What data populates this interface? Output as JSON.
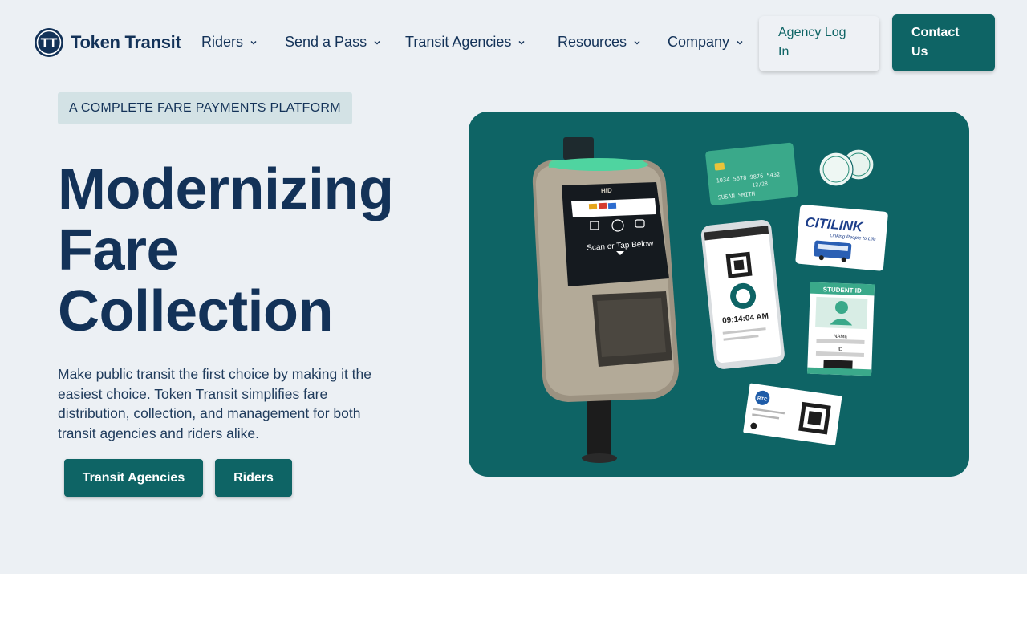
{
  "brand": {
    "name": "Token Transit",
    "logo_glyph": "TT",
    "accent": "#0e6465",
    "text_color": "#133258"
  },
  "nav": {
    "items": [
      {
        "label": "Riders",
        "icon": "chevron-down-icon"
      },
      {
        "label": "Send a Pass",
        "icon": "chevron-down-icon"
      },
      {
        "label": "Transit Agencies",
        "icon": "chevron-down-icon"
      },
      {
        "label": "Resources",
        "icon": "chevron-down-icon"
      },
      {
        "label": "Company",
        "icon": "chevron-down-icon"
      }
    ],
    "login_label": "Agency Log In",
    "contact_label": "Contact Us"
  },
  "hero": {
    "eyebrow": "A COMPLETE FARE PAYMENTS PLATFORM",
    "headline": "Modernizing Fare Collection",
    "description": "Make public transit the first choice by making it the easiest choice. Token Transit simplifies fare distribution, collection, and management for both transit agencies and riders alike.",
    "cta_agencies": "Transit Agencies",
    "cta_riders": "Riders"
  },
  "illustration": {
    "validator": {
      "brand": "HID",
      "screen_text": "Scan or Tap Below"
    },
    "credit_card": {
      "number": "1034 5678 9876 5432",
      "expiry": "12/28",
      "holder": "SUSAN SMITH"
    },
    "phone": {
      "time": "09:14:04 AM"
    },
    "citilink_card": {
      "name": "CITILINK",
      "tagline": "Linking People to Life"
    },
    "student_id": {
      "title": "STUDENT ID",
      "name_label": "NAME",
      "id_label": "ID"
    },
    "paper_ticket": {
      "logo": "RTC"
    }
  }
}
